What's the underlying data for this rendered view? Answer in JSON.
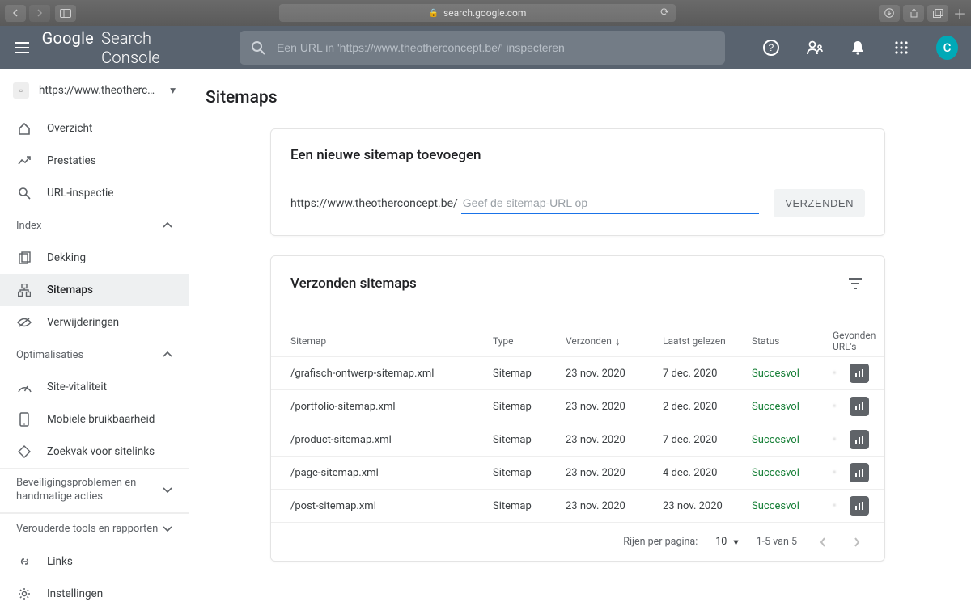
{
  "browser": {
    "url": "search.google.com"
  },
  "header": {
    "logo_a": "Google",
    "logo_b": "Search Console",
    "search_placeholder": "Een URL in 'https://www.theotherconcept.be/' inspecteren",
    "avatar_letter": "C"
  },
  "property": {
    "display": "https://www.theotherconcept..."
  },
  "sidebar": {
    "overzicht": "Overzicht",
    "prestaties": "Prestaties",
    "url_inspectie": "URL-inspectie",
    "section_index": "Index",
    "dekking": "Dekking",
    "sitemaps": "Sitemaps",
    "verwijderingen": "Verwijderingen",
    "section_opt": "Optimalisaties",
    "site_vitaliteit": "Site-vitaliteit",
    "mobiele": "Mobiele bruikbaarheid",
    "zoekvak": "Zoekvak voor sitelinks",
    "section_sec": "Beveiligingsproblemen en handmatige acties",
    "section_legacy": "Verouderde tools en rapporten",
    "links": "Links",
    "instellingen": "Instellingen"
  },
  "page": {
    "title": "Sitemaps"
  },
  "add_card": {
    "title": "Een nieuwe sitemap toevoegen",
    "prefix": "https://www.theotherconcept.be/",
    "placeholder": "Geef de sitemap-URL op",
    "submit": "VERZENDEN"
  },
  "table_card": {
    "title": "Verzonden sitemaps",
    "cols": {
      "sitemap": "Sitemap",
      "type": "Type",
      "verzonden": "Verzonden",
      "laatst": "Laatst gelezen",
      "status": "Status",
      "urls": "Gevonden URL's"
    },
    "rows": [
      {
        "sitemap": "/grafisch-ontwerp-sitemap.xml",
        "type": "Sitemap",
        "verzonden": "23 nov. 2020",
        "laatst": "7 dec. 2020",
        "status": "Succesvol"
      },
      {
        "sitemap": "/portfolio-sitemap.xml",
        "type": "Sitemap",
        "verzonden": "23 nov. 2020",
        "laatst": "2 dec. 2020",
        "status": "Succesvol"
      },
      {
        "sitemap": "/product-sitemap.xml",
        "type": "Sitemap",
        "verzonden": "23 nov. 2020",
        "laatst": "7 dec. 2020",
        "status": "Succesvol"
      },
      {
        "sitemap": "/page-sitemap.xml",
        "type": "Sitemap",
        "verzonden": "23 nov. 2020",
        "laatst": "4 dec. 2020",
        "status": "Succesvol"
      },
      {
        "sitemap": "/post-sitemap.xml",
        "type": "Sitemap",
        "verzonden": "23 nov. 2020",
        "laatst": "23 nov. 2020",
        "status": "Succesvol"
      }
    ],
    "footer": {
      "rpp_label": "Rijen per pagina:",
      "rpp_value": "10",
      "range": "1-5 van 5"
    }
  }
}
